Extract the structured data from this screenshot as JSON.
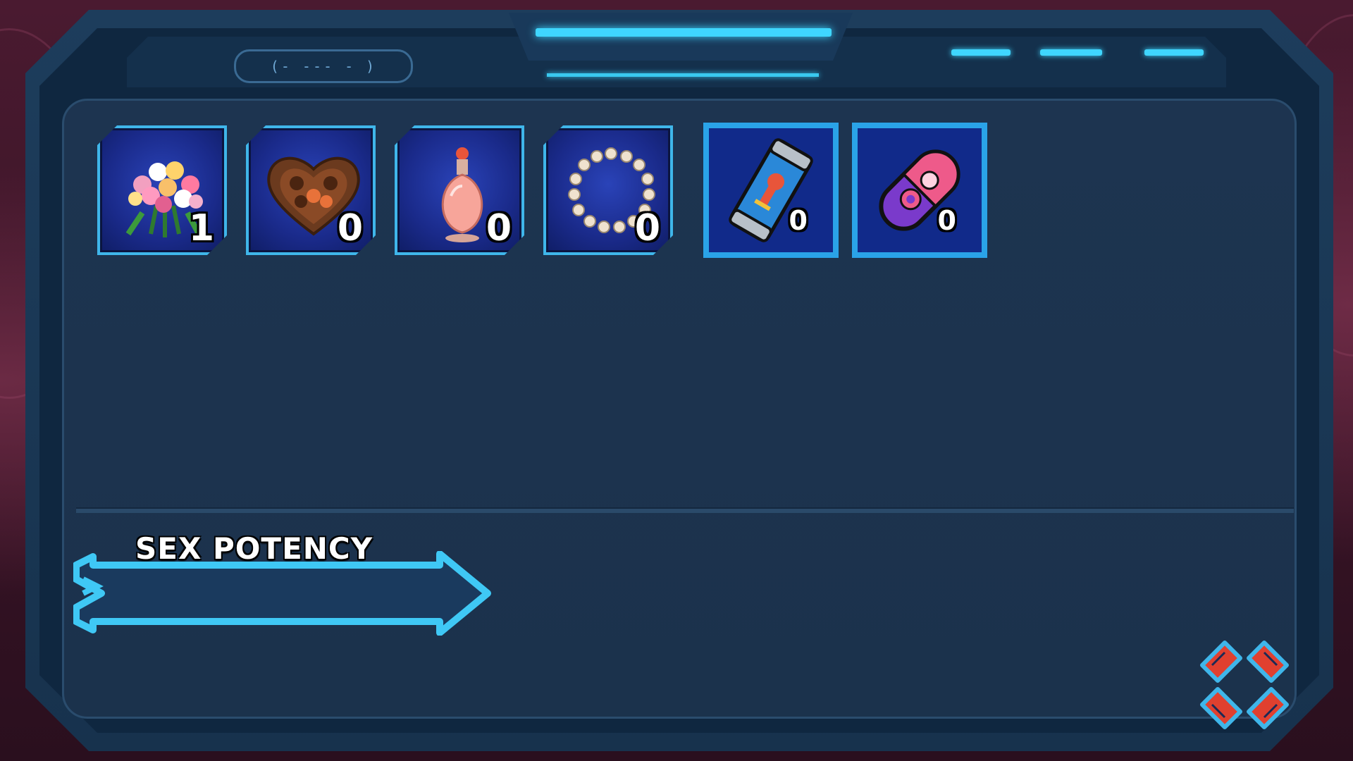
{
  "hud": {
    "display_text": "(- --- - )"
  },
  "inventory": {
    "gift_items": [
      {
        "name": "flower-bouquet",
        "count": "1"
      },
      {
        "name": "heart-chocolate-box",
        "count": "0"
      },
      {
        "name": "perfume-bottle",
        "count": "0"
      },
      {
        "name": "pearl-necklace",
        "count": "0"
      }
    ],
    "consumable_items": [
      {
        "name": "energy-drink-can",
        "count": "0"
      },
      {
        "name": "purple-pill",
        "count": "0"
      }
    ]
  },
  "stats": {
    "sex_potency": {
      "label": "SEX POTENCY",
      "fill_fraction": 0.0
    }
  },
  "colors": {
    "accent": "#3fd6ff",
    "panel": "#1b324c",
    "item_bg": "#1a2a8a",
    "close_button": "#e0402f"
  },
  "icons": {
    "close": "close-x-icon"
  }
}
